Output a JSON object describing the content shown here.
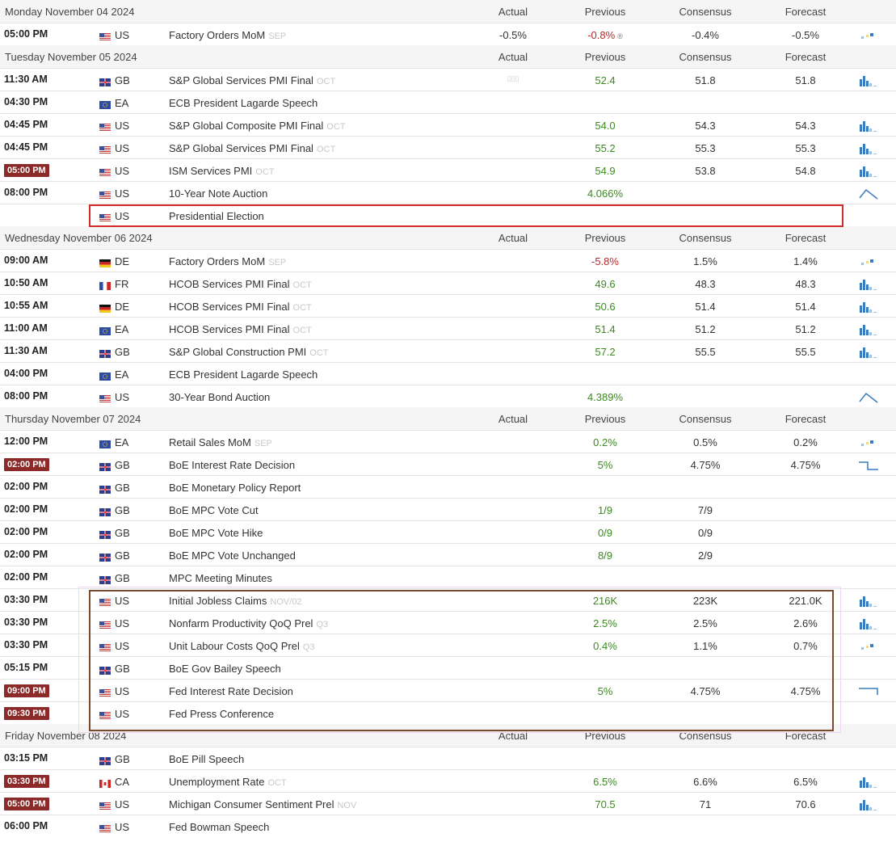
{
  "columns": {
    "actual": "Actual",
    "previous": "Previous",
    "consensus": "Consensus",
    "forecast": "Forecast"
  },
  "colors": {
    "badge": "#8c2a2a",
    "positive": "#3b8a1f",
    "negative": "#b42b2b",
    "highlight_red": "#d42a2a",
    "highlight_brown": "#7a4a2f",
    "sparkline": "#3a7cc0"
  },
  "days": [
    {
      "title": "Monday November 04 2024",
      "events": [
        {
          "time": "05:00 PM",
          "country": "US",
          "flag": "us",
          "name": "Factory Orders MoM",
          "ref": "SEP",
          "actual": "-0.5%",
          "previous": "-0.8%",
          "previous_marker": "®",
          "consensus": "-0.4%",
          "forecast": "-0.5%",
          "spark": "squares"
        }
      ]
    },
    {
      "title": "Tuesday November 05 2024",
      "events": [
        {
          "time": "11:30 AM",
          "country": "GB",
          "flag": "gb",
          "name": "S&P Global Services PMI Final",
          "ref": "OCT",
          "actual": "▯▯▯",
          "previous": "52.4",
          "consensus": "51.8",
          "forecast": "51.8",
          "spark": "bars"
        },
        {
          "time": "04:30 PM",
          "country": "EA",
          "flag": "eu",
          "name": "ECB President Lagarde Speech"
        },
        {
          "time": "04:45 PM",
          "country": "US",
          "flag": "us",
          "name": "S&P Global Composite PMI Final",
          "ref": "OCT",
          "previous": "54.0",
          "consensus": "54.3",
          "forecast": "54.3",
          "spark": "bars"
        },
        {
          "time": "04:45 PM",
          "country": "US",
          "flag": "us",
          "name": "S&P Global Services PMI Final",
          "ref": "OCT",
          "previous": "55.2",
          "consensus": "55.3",
          "forecast": "55.3",
          "spark": "bars"
        },
        {
          "time": "05:00 PM",
          "badge": true,
          "country": "US",
          "flag": "us",
          "name": "ISM Services PMI",
          "ref": "OCT",
          "previous": "54.9",
          "consensus": "53.8",
          "forecast": "54.8",
          "spark": "bars"
        },
        {
          "time": "08:00 PM",
          "country": "US",
          "flag": "us",
          "name": "10-Year Note Auction",
          "previous": "4.066%",
          "spark": "peak"
        },
        {
          "time": "",
          "country": "US",
          "flag": "us",
          "name": "Presidential Election",
          "highlight": "red"
        }
      ]
    },
    {
      "title": "Wednesday November 06 2024",
      "events": [
        {
          "time": "09:00 AM",
          "country": "DE",
          "flag": "de",
          "name": "Factory Orders MoM",
          "ref": "SEP",
          "previous": "-5.8%",
          "previous_neg": true,
          "consensus": "1.5%",
          "forecast": "1.4%",
          "spark": "squares"
        },
        {
          "time": "10:50 AM",
          "country": "FR",
          "flag": "fr",
          "name": "HCOB Services PMI Final",
          "ref": "OCT",
          "previous": "49.6",
          "consensus": "48.3",
          "forecast": "48.3",
          "spark": "bars"
        },
        {
          "time": "10:55 AM",
          "country": "DE",
          "flag": "de",
          "name": "HCOB Services PMI Final",
          "ref": "OCT",
          "previous": "50.6",
          "consensus": "51.4",
          "forecast": "51.4",
          "spark": "bars"
        },
        {
          "time": "11:00 AM",
          "country": "EA",
          "flag": "eu",
          "name": "HCOB Services PMI Final",
          "ref": "OCT",
          "previous": "51.4",
          "consensus": "51.2",
          "forecast": "51.2",
          "spark": "bars"
        },
        {
          "time": "11:30 AM",
          "country": "GB",
          "flag": "gb",
          "name": "S&P Global Construction PMI",
          "ref": "OCT",
          "previous": "57.2",
          "consensus": "55.5",
          "forecast": "55.5",
          "spark": "bars"
        },
        {
          "time": "04:00 PM",
          "country": "EA",
          "flag": "eu",
          "name": "ECB President Lagarde Speech"
        },
        {
          "time": "08:00 PM",
          "country": "US",
          "flag": "us",
          "name": "30-Year Bond Auction",
          "previous": "4.389%",
          "spark": "peak"
        }
      ]
    },
    {
      "title": "Thursday November 07 2024",
      "events": [
        {
          "time": "12:00 PM",
          "country": "EA",
          "flag": "eu",
          "name": "Retail Sales MoM",
          "ref": "SEP",
          "previous": "0.2%",
          "consensus": "0.5%",
          "forecast": "0.2%",
          "spark": "squares"
        },
        {
          "time": "02:00 PM",
          "badge": true,
          "country": "GB",
          "flag": "gb",
          "name": "BoE Interest Rate Decision",
          "previous": "5%",
          "consensus": "4.75%",
          "forecast": "4.75%",
          "spark": "stepdown"
        },
        {
          "time": "02:00 PM",
          "country": "GB",
          "flag": "gb",
          "name": "BoE Monetary Policy Report"
        },
        {
          "time": "02:00 PM",
          "country": "GB",
          "flag": "gb",
          "name": "BoE MPC Vote Cut",
          "previous": "1/9",
          "consensus": "7/9"
        },
        {
          "time": "02:00 PM",
          "country": "GB",
          "flag": "gb",
          "name": "BoE MPC Vote Hike",
          "previous": "0/9",
          "consensus": "0/9"
        },
        {
          "time": "02:00 PM",
          "country": "GB",
          "flag": "gb",
          "name": "BoE MPC Vote Unchanged",
          "previous": "8/9",
          "consensus": "2/9"
        },
        {
          "time": "02:00 PM",
          "country": "GB",
          "flag": "gb",
          "name": "MPC Meeting Minutes"
        },
        {
          "time": "03:30 PM",
          "country": "US",
          "flag": "us",
          "name": "Initial Jobless Claims",
          "ref": "NOV/02",
          "previous": "216K",
          "consensus": "223K",
          "forecast": "221.0K",
          "spark": "bars"
        },
        {
          "time": "03:30 PM",
          "country": "US",
          "flag": "us",
          "name": "Nonfarm Productivity QoQ Prel",
          "ref": "Q3",
          "previous": "2.5%",
          "consensus": "2.5%",
          "forecast": "2.6%",
          "spark": "bars"
        },
        {
          "time": "03:30 PM",
          "country": "US",
          "flag": "us",
          "name": "Unit Labour Costs QoQ Prel",
          "ref": "Q3",
          "previous": "0.4%",
          "consensus": "1.1%",
          "forecast": "0.7%",
          "spark": "squares"
        },
        {
          "time": "05:15 PM",
          "country": "GB",
          "flag": "gb",
          "name": "BoE Gov Bailey Speech"
        },
        {
          "time": "09:00 PM",
          "badge": true,
          "country": "US",
          "flag": "us",
          "name": "Fed Interest Rate Decision",
          "previous": "5%",
          "consensus": "4.75%",
          "forecast": "4.75%",
          "spark": "stepflat"
        },
        {
          "time": "09:30 PM",
          "badge": true,
          "country": "US",
          "flag": "us",
          "name": "Fed Press Conference"
        }
      ]
    },
    {
      "title": "Friday November 08 2024",
      "events": [
        {
          "time": "03:15 PM",
          "country": "GB",
          "flag": "gb",
          "name": "BoE Pill Speech"
        },
        {
          "time": "03:30 PM",
          "badge": true,
          "country": "CA",
          "flag": "ca",
          "name": "Unemployment Rate",
          "ref": "OCT",
          "previous": "6.5%",
          "consensus": "6.6%",
          "forecast": "6.5%",
          "spark": "bars"
        },
        {
          "time": "05:00 PM",
          "badge": true,
          "country": "US",
          "flag": "us",
          "name": "Michigan Consumer Sentiment Prel",
          "ref": "NOV",
          "previous": "70.5",
          "consensus": "71",
          "forecast": "70.6",
          "spark": "bars"
        },
        {
          "time": "06:00 PM",
          "country": "US",
          "flag": "us",
          "name": "Fed Bowman Speech"
        }
      ]
    }
  ]
}
